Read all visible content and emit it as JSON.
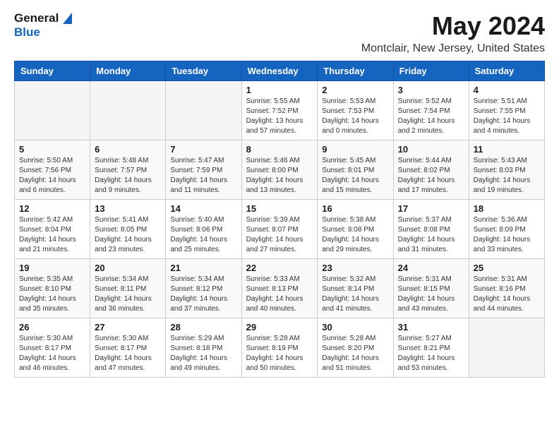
{
  "logo": {
    "general": "General",
    "blue": "Blue"
  },
  "title": "May 2024",
  "location": "Montclair, New Jersey, United States",
  "days_of_week": [
    "Sunday",
    "Monday",
    "Tuesday",
    "Wednesday",
    "Thursday",
    "Friday",
    "Saturday"
  ],
  "weeks": [
    [
      {
        "day": "",
        "info": ""
      },
      {
        "day": "",
        "info": ""
      },
      {
        "day": "",
        "info": ""
      },
      {
        "day": "1",
        "info": "Sunrise: 5:55 AM\nSunset: 7:52 PM\nDaylight: 13 hours\nand 57 minutes."
      },
      {
        "day": "2",
        "info": "Sunrise: 5:53 AM\nSunset: 7:53 PM\nDaylight: 14 hours\nand 0 minutes."
      },
      {
        "day": "3",
        "info": "Sunrise: 5:52 AM\nSunset: 7:54 PM\nDaylight: 14 hours\nand 2 minutes."
      },
      {
        "day": "4",
        "info": "Sunrise: 5:51 AM\nSunset: 7:55 PM\nDaylight: 14 hours\nand 4 minutes."
      }
    ],
    [
      {
        "day": "5",
        "info": "Sunrise: 5:50 AM\nSunset: 7:56 PM\nDaylight: 14 hours\nand 6 minutes."
      },
      {
        "day": "6",
        "info": "Sunrise: 5:48 AM\nSunset: 7:57 PM\nDaylight: 14 hours\nand 9 minutes."
      },
      {
        "day": "7",
        "info": "Sunrise: 5:47 AM\nSunset: 7:59 PM\nDaylight: 14 hours\nand 11 minutes."
      },
      {
        "day": "8",
        "info": "Sunrise: 5:46 AM\nSunset: 8:00 PM\nDaylight: 14 hours\nand 13 minutes."
      },
      {
        "day": "9",
        "info": "Sunrise: 5:45 AM\nSunset: 8:01 PM\nDaylight: 14 hours\nand 15 minutes."
      },
      {
        "day": "10",
        "info": "Sunrise: 5:44 AM\nSunset: 8:02 PM\nDaylight: 14 hours\nand 17 minutes."
      },
      {
        "day": "11",
        "info": "Sunrise: 5:43 AM\nSunset: 8:03 PM\nDaylight: 14 hours\nand 19 minutes."
      }
    ],
    [
      {
        "day": "12",
        "info": "Sunrise: 5:42 AM\nSunset: 8:04 PM\nDaylight: 14 hours\nand 21 minutes."
      },
      {
        "day": "13",
        "info": "Sunrise: 5:41 AM\nSunset: 8:05 PM\nDaylight: 14 hours\nand 23 minutes."
      },
      {
        "day": "14",
        "info": "Sunrise: 5:40 AM\nSunset: 8:06 PM\nDaylight: 14 hours\nand 25 minutes."
      },
      {
        "day": "15",
        "info": "Sunrise: 5:39 AM\nSunset: 8:07 PM\nDaylight: 14 hours\nand 27 minutes."
      },
      {
        "day": "16",
        "info": "Sunrise: 5:38 AM\nSunset: 8:08 PM\nDaylight: 14 hours\nand 29 minutes."
      },
      {
        "day": "17",
        "info": "Sunrise: 5:37 AM\nSunset: 8:08 PM\nDaylight: 14 hours\nand 31 minutes."
      },
      {
        "day": "18",
        "info": "Sunrise: 5:36 AM\nSunset: 8:09 PM\nDaylight: 14 hours\nand 33 minutes."
      }
    ],
    [
      {
        "day": "19",
        "info": "Sunrise: 5:35 AM\nSunset: 8:10 PM\nDaylight: 14 hours\nand 35 minutes."
      },
      {
        "day": "20",
        "info": "Sunrise: 5:34 AM\nSunset: 8:11 PM\nDaylight: 14 hours\nand 36 minutes."
      },
      {
        "day": "21",
        "info": "Sunrise: 5:34 AM\nSunset: 8:12 PM\nDaylight: 14 hours\nand 37 minutes."
      },
      {
        "day": "22",
        "info": "Sunrise: 5:33 AM\nSunset: 8:13 PM\nDaylight: 14 hours\nand 40 minutes."
      },
      {
        "day": "23",
        "info": "Sunrise: 5:32 AM\nSunset: 8:14 PM\nDaylight: 14 hours\nand 41 minutes."
      },
      {
        "day": "24",
        "info": "Sunrise: 5:31 AM\nSunset: 8:15 PM\nDaylight: 14 hours\nand 43 minutes."
      },
      {
        "day": "25",
        "info": "Sunrise: 5:31 AM\nSunset: 8:16 PM\nDaylight: 14 hours\nand 44 minutes."
      }
    ],
    [
      {
        "day": "26",
        "info": "Sunrise: 5:30 AM\nSunset: 8:17 PM\nDaylight: 14 hours\nand 46 minutes."
      },
      {
        "day": "27",
        "info": "Sunrise: 5:30 AM\nSunset: 8:17 PM\nDaylight: 14 hours\nand 47 minutes."
      },
      {
        "day": "28",
        "info": "Sunrise: 5:29 AM\nSunset: 8:18 PM\nDaylight: 14 hours\nand 49 minutes."
      },
      {
        "day": "29",
        "info": "Sunrise: 5:28 AM\nSunset: 8:19 PM\nDaylight: 14 hours\nand 50 minutes."
      },
      {
        "day": "30",
        "info": "Sunrise: 5:28 AM\nSunset: 8:20 PM\nDaylight: 14 hours\nand 51 minutes."
      },
      {
        "day": "31",
        "info": "Sunrise: 5:27 AM\nSunset: 8:21 PM\nDaylight: 14 hours\nand 53 minutes."
      },
      {
        "day": "",
        "info": ""
      }
    ]
  ]
}
